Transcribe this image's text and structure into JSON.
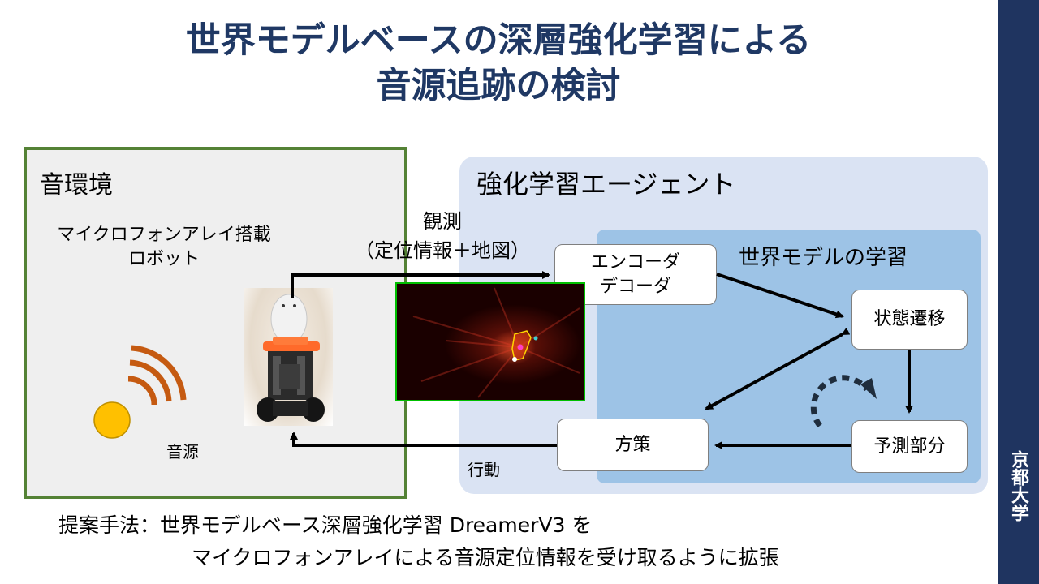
{
  "title": {
    "line1": "世界モデルベースの深層強化学習による",
    "line2": "音源追跡の検討"
  },
  "university": "京都大学",
  "environment": {
    "title": "音環境",
    "robot_label_line1": "マイクロフォンアレイ搭載",
    "robot_label_line2": "ロボット",
    "source_label": "音源"
  },
  "observation": {
    "line1": "観測",
    "line2": "（定位情報＋地図）"
  },
  "agent": {
    "title": "強化学習エージェント",
    "world_model_title": "世界モデルの学習",
    "encoder_line1": "エンコーダ",
    "encoder_line2": "デコーダ",
    "transition": "状態遷移",
    "prediction": "予測部分",
    "policy": "方策",
    "action_label": "行動"
  },
  "caption": {
    "line1": "提案手法：世界モデルベース深層強化学習 DreamerV3 を",
    "line2": "マイクロフォンアレイによる音源定位情報を受け取るように拡張"
  },
  "colors": {
    "title": "#1f3864",
    "univ_band": "#1f3460",
    "env_border": "#548235",
    "agent_bg": "#dae3f3",
    "world_model_bg": "#9dc3e6",
    "source_fill": "#ffc000",
    "wave_stroke": "#c55a11"
  },
  "icons": [
    "sound-source-icon",
    "sound-wave-icon",
    "robot-photo",
    "heatmap-image",
    "cycle-arrow-icon"
  ]
}
